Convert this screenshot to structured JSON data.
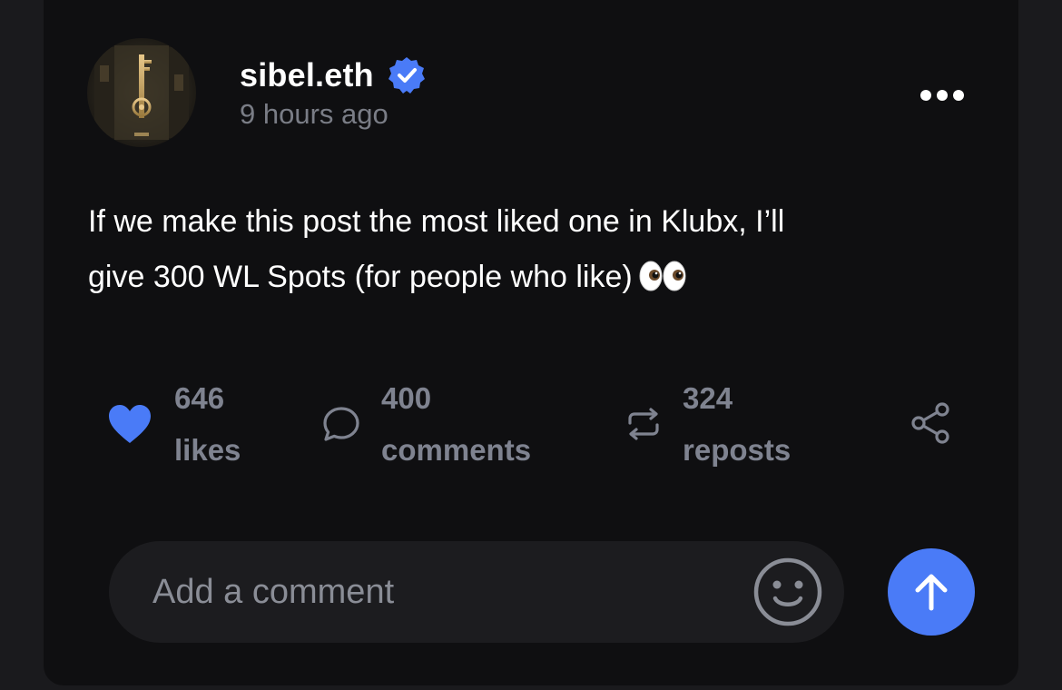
{
  "post": {
    "author": {
      "username": "sibel.eth",
      "timestamp": "9 hours ago"
    },
    "text_line1": "If we make this post the most liked one in Klubx, I’ll",
    "text_line2": "give 300 WL Spots (for people who like)",
    "emoji": "eyes-emoji"
  },
  "actions": {
    "likes": {
      "count": "646",
      "label": "likes",
      "icon": "heart-icon"
    },
    "comments": {
      "count": "400",
      "label": "comments",
      "icon": "comment-bubble-icon"
    },
    "reposts": {
      "count": "324",
      "label": "reposts",
      "icon": "repost-icon"
    },
    "share": {
      "icon": "share-icon"
    }
  },
  "composer": {
    "placeholder": "Add a comment",
    "emoji_icon": "smiley-icon",
    "send_icon": "arrow-up-icon"
  },
  "colors": {
    "accent": "#4a7bf7",
    "background": "#0f0f11",
    "muted_text": "#7f8390"
  }
}
